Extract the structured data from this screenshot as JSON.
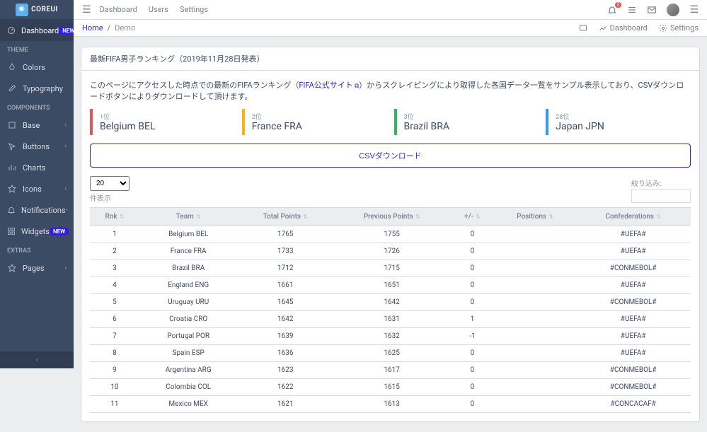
{
  "brand": {
    "text": "COREUI"
  },
  "sidebar": {
    "main_item": {
      "label": "Dashboard",
      "badge": "NEW"
    },
    "theme_title": "THEME",
    "theme_items": [
      {
        "label": "Colors"
      },
      {
        "label": "Typography"
      }
    ],
    "components_title": "COMPONENTS",
    "component_items": [
      {
        "label": "Base"
      },
      {
        "label": "Buttons"
      },
      {
        "label": "Charts"
      },
      {
        "label": "Icons"
      },
      {
        "label": "Notifications"
      },
      {
        "label": "Widgets",
        "badge": "NEW"
      }
    ],
    "extras_title": "EXTRAS",
    "extras_items": [
      {
        "label": "Pages"
      }
    ]
  },
  "header": {
    "nav": [
      "Dashboard",
      "Users",
      "Settings"
    ],
    "notification_count": "5"
  },
  "subheader": {
    "breadcrumb_home": "Home",
    "breadcrumb_current": "Demo",
    "right_items": [
      {
        "label": "Dashboard"
      },
      {
        "label": "Settings"
      }
    ]
  },
  "card": {
    "header": "最新FIFA男子ランキング（2019年11月28日発表）",
    "desc_pre": "このページにアクセスした時点での最新のFIFAランキング（",
    "desc_link": "FIFA公式サイト",
    "desc_post": "）からスクレイピングにより取得した各国データ一覧をサンプル表示しており、CSVダウンロードボタンによりダウンロードして頂けます。"
  },
  "ranks": [
    {
      "pos": "1位",
      "name": "Belgium BEL",
      "color": "red"
    },
    {
      "pos": "2位",
      "name": "France FRA",
      "color": "yellow"
    },
    {
      "pos": "3位",
      "name": "Brazil BRA",
      "color": "green"
    },
    {
      "pos": "28位",
      "name": "Japan JPN",
      "color": "blue"
    }
  ],
  "csv_button": "CSVダウンロード",
  "table_controls": {
    "page_size_value": "20",
    "page_size_label": "件表示",
    "filter_label": "絞り込み:"
  },
  "table": {
    "headers": [
      "Rnk",
      "Team",
      "Total Points",
      "Previous Points",
      "+/-",
      "Positions",
      "Confederations"
    ],
    "rows": [
      [
        "1",
        "Belgium BEL",
        "1765",
        "1755",
        "0",
        "",
        "#UEFA#"
      ],
      [
        "2",
        "France FRA",
        "1733",
        "1726",
        "0",
        "",
        "#UEFA#"
      ],
      [
        "3",
        "Brazil BRA",
        "1712",
        "1715",
        "0",
        "",
        "#CONMEBOL#"
      ],
      [
        "4",
        "England ENG",
        "1661",
        "1651",
        "0",
        "",
        "#UEFA#"
      ],
      [
        "5",
        "Uruguay URU",
        "1645",
        "1642",
        "0",
        "",
        "#CONMEBOL#"
      ],
      [
        "6",
        "Croatia CRO",
        "1642",
        "1631",
        "1",
        "",
        "#UEFA#"
      ],
      [
        "7",
        "Portugal POR",
        "1639",
        "1632",
        "-1",
        "",
        "#UEFA#"
      ],
      [
        "8",
        "Spain ESP",
        "1636",
        "1625",
        "0",
        "",
        "#UEFA#"
      ],
      [
        "9",
        "Argentina ARG",
        "1623",
        "1617",
        "0",
        "",
        "#CONMEBOL#"
      ],
      [
        "10",
        "Colombia COL",
        "1622",
        "1615",
        "0",
        "",
        "#CONMEBOL#"
      ],
      [
        "11",
        "Mexico MEX",
        "1621",
        "1613",
        "0",
        "",
        "#CONCACAF#"
      ]
    ]
  }
}
